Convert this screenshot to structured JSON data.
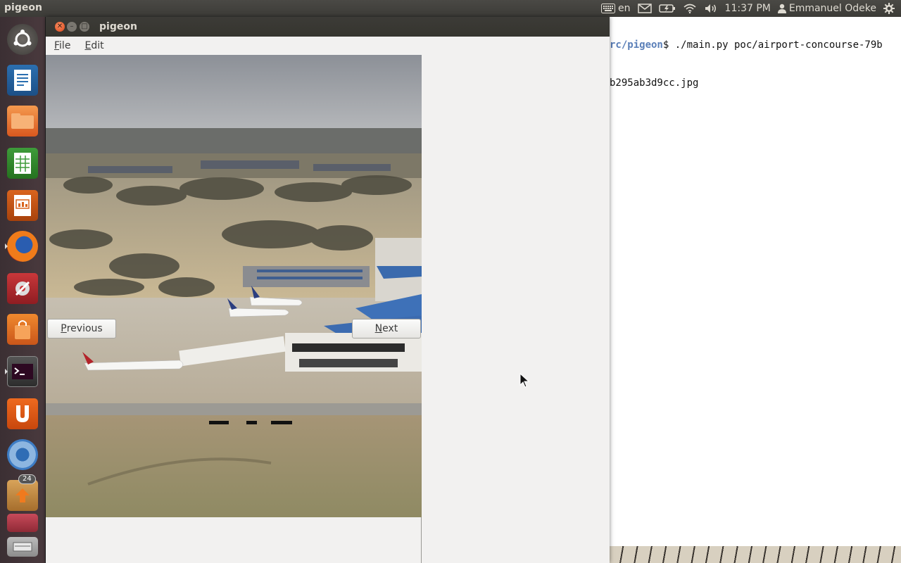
{
  "panel": {
    "app_title": "pigeon",
    "keyboard_layout": "en",
    "clock": "11:37 PM",
    "user_name": "Emmanuel Odeke"
  },
  "terminal": {
    "path_fragment": "rc/pigeon",
    "command_line": "$ ./main.py poc/airport-concourse-79b",
    "output_line": "b295ab3d9cc.jpg"
  },
  "launcher": {
    "items": [
      {
        "name": "ubuntu-dash"
      },
      {
        "name": "libreoffice-writer"
      },
      {
        "name": "files"
      },
      {
        "name": "libreoffice-calc"
      },
      {
        "name": "libreoffice-impress"
      },
      {
        "name": "firefox"
      },
      {
        "name": "system-settings"
      },
      {
        "name": "software-center"
      },
      {
        "name": "terminal"
      },
      {
        "name": "ubuntu-one"
      },
      {
        "name": "chromium"
      },
      {
        "name": "update-manager"
      },
      {
        "name": "printer"
      },
      {
        "name": "scanner"
      }
    ],
    "update_badge": "24"
  },
  "window": {
    "title": "pigeon",
    "menu": {
      "file": {
        "mnemonic": "F",
        "rest": "ile"
      },
      "edit": {
        "mnemonic": "E",
        "rest": "dit"
      }
    },
    "previous": {
      "mnemonic": "P",
      "rest": "revious"
    },
    "next": {
      "mnemonic": "N",
      "rest": "ext"
    }
  },
  "colors": {
    "panel_bg": "#3c3b37",
    "close_button": "#e0491c",
    "window_bg": "#f2f1f0",
    "terminal_path": "#5a7fb8"
  }
}
